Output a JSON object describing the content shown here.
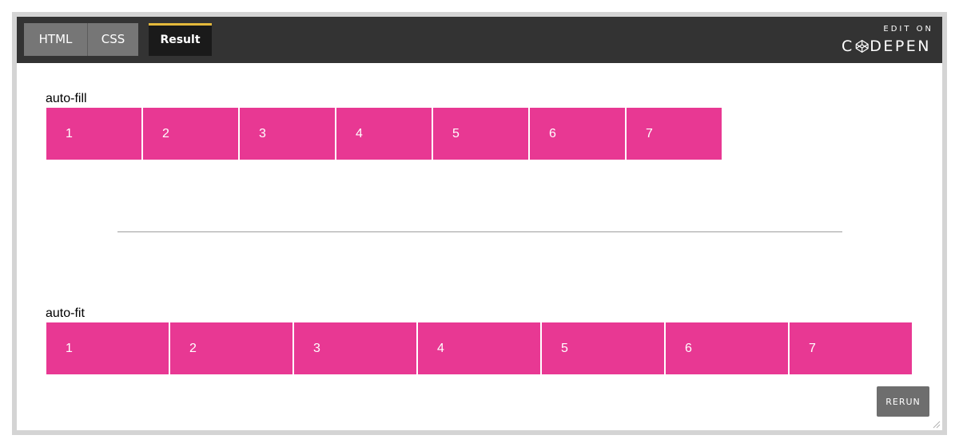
{
  "tabs": {
    "html": "HTML",
    "css": "CSS",
    "result": "Result"
  },
  "brand": {
    "edit_on": "EDIT ON",
    "name_pre": "C",
    "name_post": "DEPEN"
  },
  "sections": {
    "auto_fill": {
      "label": "auto-fill",
      "items": [
        "1",
        "2",
        "3",
        "4",
        "5",
        "6",
        "7"
      ]
    },
    "auto_fit": {
      "label": "auto-fit",
      "items": [
        "1",
        "2",
        "3",
        "4",
        "5",
        "6",
        "7"
      ]
    }
  },
  "rerun_label": "RERUN",
  "colors": {
    "accent": "#e83893",
    "topbar": "#333333",
    "active_tab_border": "#e4b93b"
  },
  "icons": {
    "logo": "codepen-cube-icon",
    "resize": "resize-grip-icon"
  }
}
